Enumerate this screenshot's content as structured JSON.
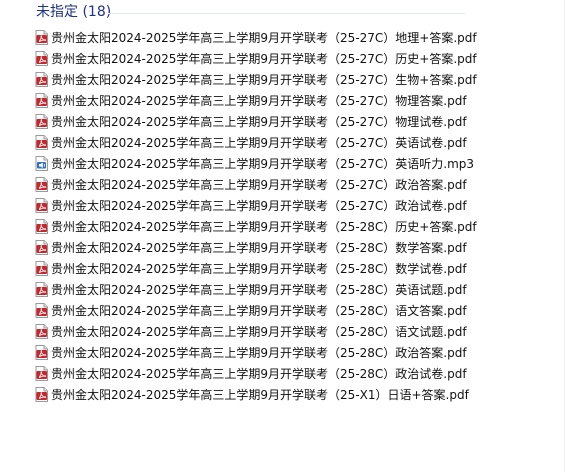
{
  "group": {
    "label": "未指定 (18)"
  },
  "files": [
    {
      "name": "贵州金太阳2024-2025学年高三上学期9月开学联考（25-27C）地理+答案.pdf",
      "icon": "pdf-icon"
    },
    {
      "name": "贵州金太阳2024-2025学年高三上学期9月开学联考（25-27C）历史+答案.pdf",
      "icon": "pdf-icon"
    },
    {
      "name": "贵州金太阳2024-2025学年高三上学期9月开学联考（25-27C）生物+答案.pdf",
      "icon": "pdf-icon"
    },
    {
      "name": "贵州金太阳2024-2025学年高三上学期9月开学联考（25-27C）物理答案.pdf",
      "icon": "pdf-icon"
    },
    {
      "name": "贵州金太阳2024-2025学年高三上学期9月开学联考（25-27C）物理试卷.pdf",
      "icon": "pdf-icon"
    },
    {
      "name": "贵州金太阳2024-2025学年高三上学期9月开学联考（25-27C）英语试卷.pdf",
      "icon": "pdf-icon"
    },
    {
      "name": "贵州金太阳2024-2025学年高三上学期9月开学联考（25-27C）英语听力.mp3",
      "icon": "audio-icon"
    },
    {
      "name": "贵州金太阳2024-2025学年高三上学期9月开学联考（25-27C）政治答案.pdf",
      "icon": "pdf-icon"
    },
    {
      "name": "贵州金太阳2024-2025学年高三上学期9月开学联考（25-27C）政治试卷.pdf",
      "icon": "pdf-icon"
    },
    {
      "name": "贵州金太阳2024-2025学年高三上学期9月开学联考（25-28C）历史+答案.pdf",
      "icon": "pdf-icon"
    },
    {
      "name": "贵州金太阳2024-2025学年高三上学期9月开学联考（25-28C）数学答案.pdf",
      "icon": "pdf-icon"
    },
    {
      "name": "贵州金太阳2024-2025学年高三上学期9月开学联考（25-28C）数学试卷.pdf",
      "icon": "pdf-icon"
    },
    {
      "name": "贵州金太阳2024-2025学年高三上学期9月开学联考（25-28C）英语试题.pdf",
      "icon": "pdf-icon"
    },
    {
      "name": "贵州金太阳2024-2025学年高三上学期9月开学联考（25-28C）语文答案.pdf",
      "icon": "pdf-icon"
    },
    {
      "name": "贵州金太阳2024-2025学年高三上学期9月开学联考（25-28C）语文试题.pdf",
      "icon": "pdf-icon"
    },
    {
      "name": "贵州金太阳2024-2025学年高三上学期9月开学联考（25-28C）政治答案.pdf",
      "icon": "pdf-icon"
    },
    {
      "name": "贵州金太阳2024-2025学年高三上学期9月开学联考（25-28C）政治试卷.pdf",
      "icon": "pdf-icon"
    },
    {
      "name": "贵州金太阳2024-2025学年高三上学期9月开学联考（25-X1）日语+答案.pdf",
      "icon": "pdf-icon"
    }
  ],
  "colors": {
    "group_header": "#1e3287",
    "pdf_icon_red": "#c8262c",
    "audio_icon_blue": "#2f6fc0"
  }
}
